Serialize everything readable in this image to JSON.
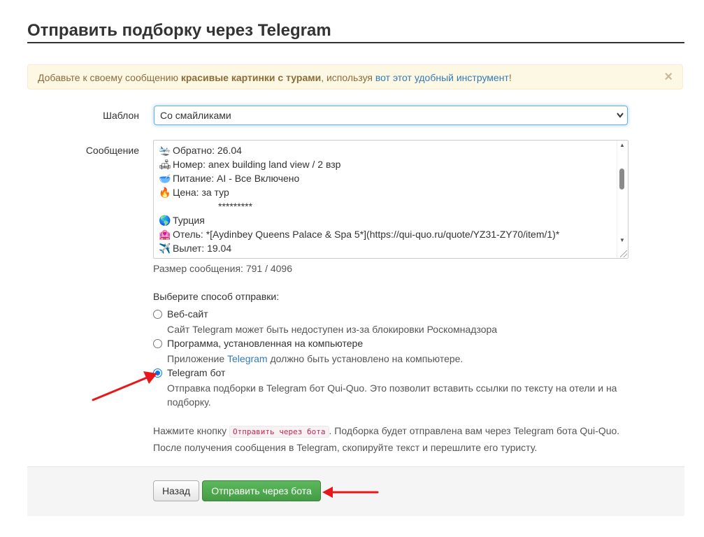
{
  "page": {
    "title": "Отправить подборку через Telegram"
  },
  "alert": {
    "text_before": "Добавьте к своему сообщению ",
    "bold_text": "красивые картинки с турами",
    "text_middle": ", используя ",
    "link_text": "вот этот удобный инструмент",
    "text_after": "!",
    "close_glyph": "×"
  },
  "form": {
    "template_label": "Шаблон",
    "template_value": "Со смайликами",
    "message_label": "Сообщение",
    "message_lines": [
      {
        "icon": "🛬",
        "text": "Обратно: 26.04"
      },
      {
        "icon": "🛋",
        "text": "Номер: anex building land view / 2 взр"
      },
      {
        "icon": "🥣",
        "text": "Питание: AI - Все Включено"
      },
      {
        "icon": "🔥",
        "text": "Цена: за тур"
      },
      {
        "icon": "",
        "text": "*********"
      },
      {
        "icon": "🌎",
        "text": "Турция"
      },
      {
        "icon": "🏩",
        "text": "Отель: *[Aydinbey Queens Palace & Spa 5*](https://qui-quo.ru/quote/YZ31-ZY70/item/1)*"
      },
      {
        "icon": "✈️",
        "text": "Вылет: 19.04"
      }
    ],
    "message_size": "Размер сообщения: 791 / 4096"
  },
  "send_method": {
    "label": "Выберите способ отправки:",
    "options": [
      {
        "title": "Веб-сайт",
        "desc": "Сайт Telegram может быть недоступен из-за блокировки Роскомнадзора",
        "checked": false
      },
      {
        "title": "Программа, установленная на компьютере",
        "desc_before": "Приложение ",
        "desc_link": "Telegram",
        "desc_after": " должно быть установлено на компьютере.",
        "checked": false
      },
      {
        "title": "Telegram бот",
        "desc": "Отправка подборки в Telegram бот Qui-Quo. Это позволит вставить ссылки по тексту на отели и на подборку.",
        "checked": true
      }
    ]
  },
  "hint": {
    "before": "Нажмите кнопку ",
    "code": "Отправить через бота",
    "after": ". Подборка будет отправлена вам через Telegram бота Qui-Quo.",
    "line2": "После получения сообщения в Telegram, скопируйте текст и перешлите его туристу."
  },
  "buttons": {
    "back": "Назад",
    "send": "Отправить через бота"
  },
  "colors": {
    "link": "#337ab7",
    "alert_bg": "#fcf8e3",
    "success": "#5cb85c",
    "arrow": "#e8171b",
    "radio_checked": "#0075ff"
  }
}
